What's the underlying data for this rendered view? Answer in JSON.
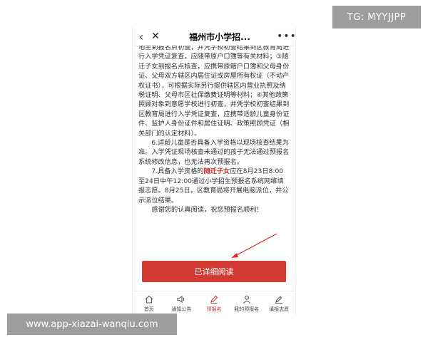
{
  "watermark": {
    "tg": "TG: MYYJJPP",
    "site": "www.app-xiazai-wanqiu.com"
  },
  "header": {
    "title": "福州市小学招...",
    "back_icon": "back-arrow-icon",
    "close_icon": "close-icon",
    "more_icon": "more-dots-icon"
  },
  "article": {
    "p1": "地至到报名点初查，并凭学校初查结果到区教育局进行入学凭证复查，应随带原户口簿等有关材料；③随迁子女到报名点核查，应携带原籍户口簿和父母身份证、父母双方辖区内居住证或房屋所有权证（不动产权证书），可根据实际另行提供辖区内营业执照及纳税证明、父母市区社保缴费证明等材料；④其他政策照顾对象到意愿学校进行初查，并凭学校初查结果到区教育局进行入学凭证复查，应携带适龄儿童身份证件、监护人身份证件和居住证明、政策照顾凭证（相关部门的认定材料）。",
    "p2": "6.适龄儿童是否具备入学资格以现场核查结果为准。入学凭证现场核查未通过的孩子无法通过预报名系统修改信息，也无法再次预报名。",
    "p3_pre": "7.具备入学资格的",
    "p3_highlight": "随迁子女",
    "p3_post": "应在8月23日8:00至24日中午12:00通过小学招生预报名系统网络填报志愿。8月25日，区教育局将开展电脑派位，并公示派位结果。",
    "p4": "感谢您的认真阅读，祝您预报名顺利！"
  },
  "cta": {
    "label": "已详细阅读"
  },
  "colors": {
    "accent": "#d23b34",
    "highlight": "#d0312d"
  },
  "bottom_nav": [
    {
      "label": "首页",
      "icon": "home-icon",
      "active": false
    },
    {
      "label": "通知公告",
      "icon": "speaker-icon",
      "active": false
    },
    {
      "label": "预报名",
      "icon": "pen-icon",
      "active": true
    },
    {
      "label": "我的预报名",
      "icon": "user-icon",
      "active": false
    },
    {
      "label": "填报志愿",
      "icon": "edit-icon",
      "active": false
    }
  ]
}
